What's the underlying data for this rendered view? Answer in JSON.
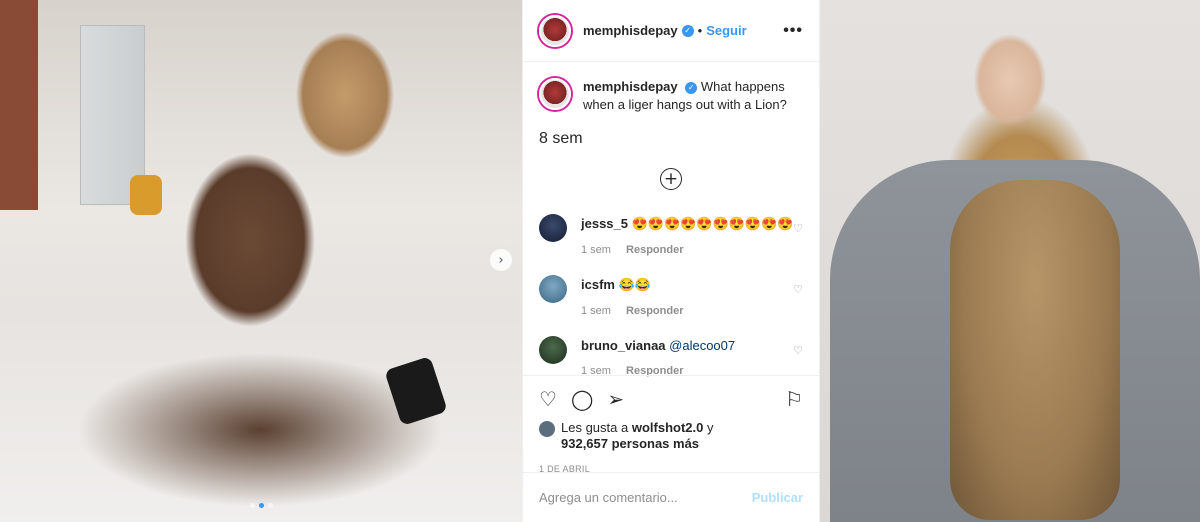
{
  "post": {
    "username": "memphisdepay",
    "separator": "•",
    "follow_label": "Seguir",
    "more_label": "•••",
    "caption_text": "What happens when a liger hangs out with a Lion?",
    "caption_time": "8 sem",
    "load_more_icon": "plus-circle-icon",
    "comments": [
      {
        "username": "jesss_5",
        "text": "😍😍😍😍😍😍😍😍😍😍",
        "time": "1 sem",
        "reply": "Responder"
      },
      {
        "username": "icsfm",
        "text": "😂😂",
        "time": "1 sem",
        "reply": "Responder"
      },
      {
        "username": "bruno_vianaa",
        "mention": "@alecoo07",
        "time": "1 sem",
        "reply": "Responder"
      }
    ],
    "likes_prefix": "Les gusta a",
    "likes_user": "wolfshot2.0",
    "likes_middle": "y",
    "likes_count": "932,657 personas más",
    "date": "1 DE ABRIL",
    "comment_placeholder": "Agrega un comentario...",
    "publish_label": "Publicar"
  },
  "carousel": {
    "current_slide": 2,
    "total_slides": 3
  },
  "colors": {
    "accent": "#3897f0",
    "muted": "#8e8e8e",
    "publish_disabled": "#b2dffc"
  }
}
